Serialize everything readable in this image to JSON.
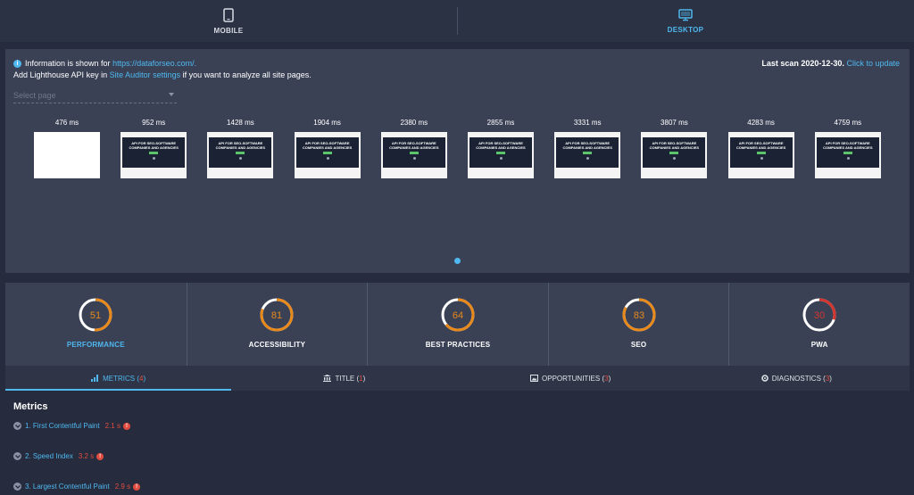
{
  "devices": {
    "mobile": {
      "label": "MOBILE",
      "icon": "phone-icon"
    },
    "desktop": {
      "label": "DESKTOP",
      "icon": "monitor-icon"
    }
  },
  "info": {
    "prefix": "Information is shown for",
    "url": "https://dataforseo.com/.",
    "line2_prefix": "Add Lighthouse API key in",
    "line2_link": "Site Auditor settings",
    "line2_suffix": "if you want to analyze all site pages.",
    "last_scan_label": "Last scan 2020-12-30.",
    "update_link": "Click to update"
  },
  "select_page": {
    "placeholder": "Select page"
  },
  "frames": [
    {
      "ms": "476 ms",
      "blank": true
    },
    {
      "ms": "952 ms"
    },
    {
      "ms": "1428 ms"
    },
    {
      "ms": "1904 ms"
    },
    {
      "ms": "2380 ms"
    },
    {
      "ms": "2855 ms"
    },
    {
      "ms": "3331 ms"
    },
    {
      "ms": "3807 ms"
    },
    {
      "ms": "4283 ms"
    },
    {
      "ms": "4759 ms"
    }
  ],
  "thumb_headline": "API FOR SEO-SOFTWARE COMPANIES AND AGENCIES",
  "scores": [
    {
      "label": "PERFORMANCE",
      "value": "51",
      "score": 51,
      "color": "#e8891a"
    },
    {
      "label": "ACCESSIBILITY",
      "value": "81",
      "score": 81,
      "color": "#e8891a"
    },
    {
      "label": "BEST PRACTICES",
      "value": "64",
      "score": 64,
      "color": "#e8891a"
    },
    {
      "label": "SEO",
      "value": "83",
      "score": 83,
      "color": "#e8891a"
    },
    {
      "label": "PWA",
      "value": "30",
      "score": 30,
      "color": "#d4362f"
    }
  ],
  "tabs": [
    {
      "label": "METRICS",
      "count": "4"
    },
    {
      "label": "TITLE",
      "count": "1"
    },
    {
      "label": "OPPORTUNITIES",
      "count": "3"
    },
    {
      "label": "DIAGNOSTICS",
      "count": "3"
    }
  ],
  "metrics": {
    "title": "Metrics",
    "items": [
      {
        "name": "1. First Contentful Paint",
        "value": "2.1 s"
      },
      {
        "name": "2. Speed Index",
        "value": "3.2 s"
      },
      {
        "name": "3. Largest Contentful Paint",
        "value": "2.9 s"
      }
    ]
  },
  "colors": {
    "accent": "#4fb8ef",
    "warning": "#e04c3f",
    "orange": "#e8891a",
    "red": "#d4362f"
  }
}
